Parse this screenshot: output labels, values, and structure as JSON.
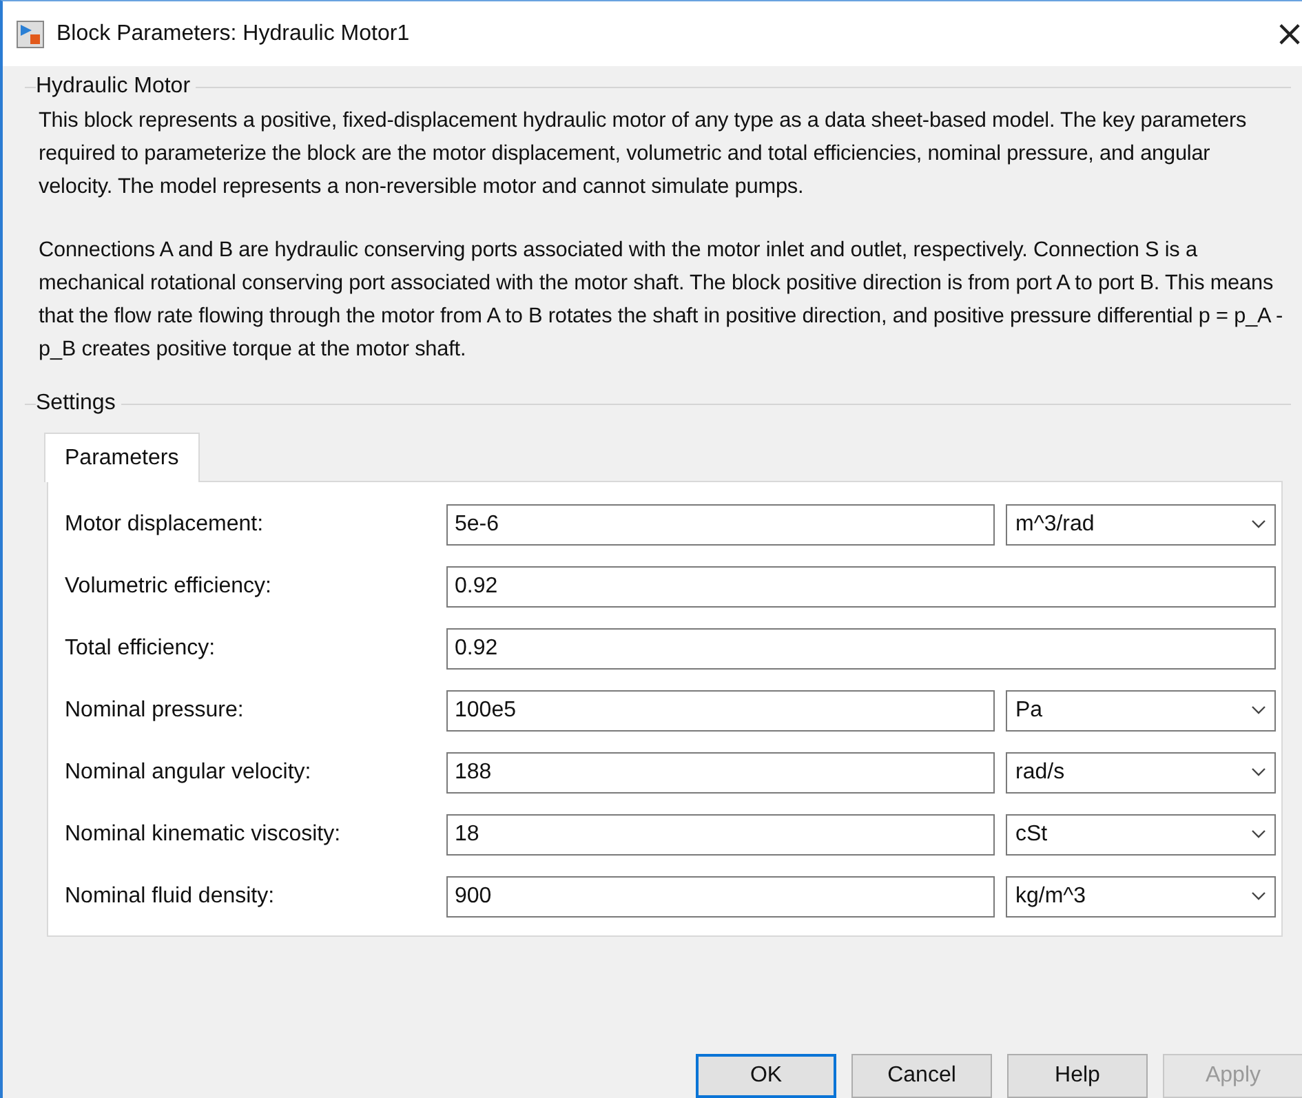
{
  "window": {
    "title": "Block Parameters: Hydraulic Motor1",
    "close": "×"
  },
  "description_group": {
    "title": "Hydraulic Motor",
    "paragraphs": [
      "This block represents a positive, fixed-displacement hydraulic motor of any type as a data sheet-based model. The key parameters required to parameterize the block are the motor displacement, volumetric and total efficiencies, nominal pressure, and angular velocity. The model represents a non-reversible motor and cannot simulate pumps.",
      "Connections A and B are hydraulic conserving ports associated with the motor inlet and outlet, respectively. Connection S is a mechanical rotational conserving port associated with the motor shaft. The block positive direction is from port A to port B. This means that the flow rate flowing through the motor from A to B rotates the shaft in positive direction, and positive pressure differential p = p_A - p_B creates positive torque at the motor shaft."
    ]
  },
  "settings": {
    "title": "Settings",
    "tabs": [
      {
        "label": "Parameters",
        "selected": true
      }
    ],
    "parameters": [
      {
        "kind": "unit",
        "label": "Motor displacement:",
        "value": "5e-6",
        "unit": "m^3/rad"
      },
      {
        "kind": "plain",
        "label": "Volumetric efficiency:",
        "value": "0.92"
      },
      {
        "kind": "plain",
        "label": "Total efficiency:",
        "value": "0.92"
      },
      {
        "kind": "unit",
        "label": "Nominal pressure:",
        "value": "100e5",
        "unit": "Pa"
      },
      {
        "kind": "unit",
        "label": "Nominal angular velocity:",
        "value": "188",
        "unit": "rad/s"
      },
      {
        "kind": "unit",
        "label": "Nominal kinematic viscosity:",
        "value": "18",
        "unit": "cSt"
      },
      {
        "kind": "unit",
        "label": "Nominal fluid density:",
        "value": "900",
        "unit": "kg/m^3"
      }
    ]
  },
  "buttons": [
    {
      "label": "OK",
      "default": true,
      "disabled": false
    },
    {
      "label": "Cancel",
      "default": false,
      "disabled": false
    },
    {
      "label": "Help",
      "default": false,
      "disabled": false
    },
    {
      "label": "Apply",
      "default": false,
      "disabled": true
    }
  ]
}
